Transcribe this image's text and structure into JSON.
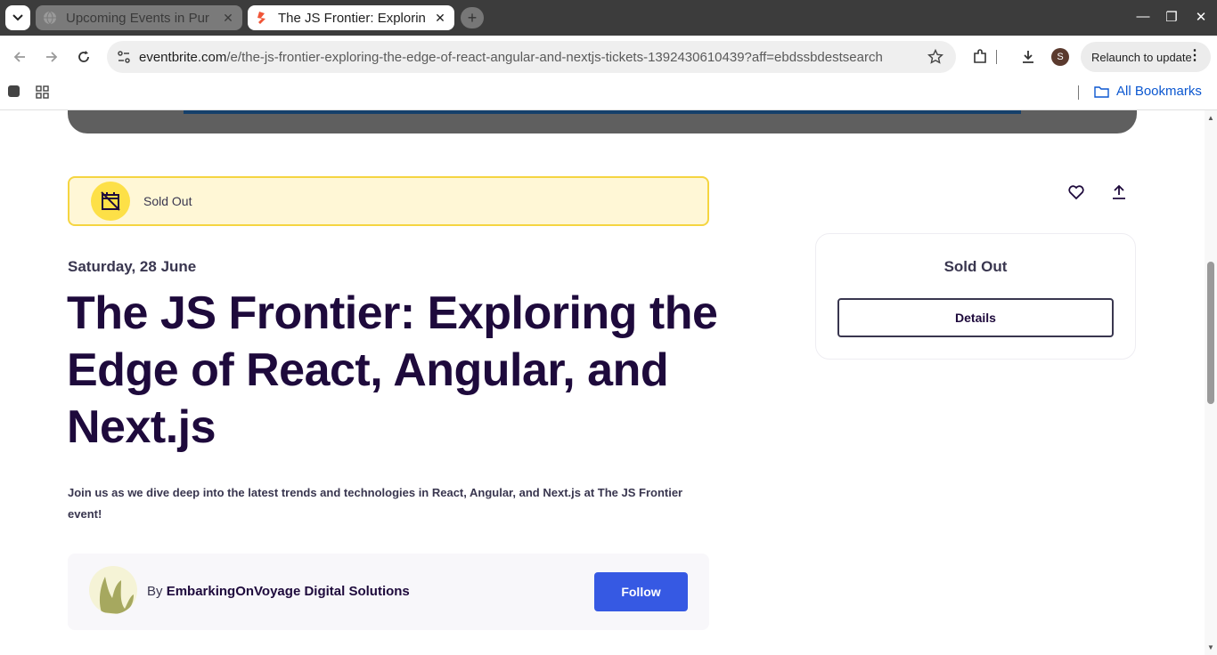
{
  "browser": {
    "tabs": [
      {
        "title": "Upcoming Events in Pur",
        "active": false
      },
      {
        "title": "The JS Frontier: Explorin",
        "active": true
      }
    ],
    "url": {
      "domain": "eventbrite.com",
      "path": "/e/the-js-frontier-exploring-the-edge-of-react-angular-and-nextjs-tickets-1392430610439?aff=ebdssbdestsearch"
    },
    "profile_initial": "S",
    "relaunch_label": "Relaunch to update",
    "all_bookmarks_label": "All Bookmarks"
  },
  "event": {
    "status_banner": "Sold Out",
    "date": "Saturday, 28 June",
    "title": "The JS Frontier: Exploring the Edge of React, Angular, and Next.js",
    "summary": "Join us as we dive deep into the latest trends and technologies in React, Angular, and Next.js at The JS Frontier event!",
    "organizer_prefix": "By",
    "organizer_name": "EmbarkingOnVoyage Digital Solutions",
    "follow_label": "Follow"
  },
  "ticket_card": {
    "status": "Sold Out",
    "details_label": "Details"
  },
  "colors": {
    "brand_accent": "#3659e3",
    "title_text": "#1e0a3c",
    "banner_bg": "#fff7d6",
    "banner_border": "#f5d541"
  },
  "icons": [
    "chevron-down-icon",
    "globe-icon",
    "eventbrite-favicon",
    "close-icon",
    "plus-icon",
    "minimize-icon",
    "maximize-icon",
    "window-close-icon",
    "back-icon",
    "forward-icon",
    "reload-icon",
    "site-info-icon",
    "star-icon",
    "extensions-icon",
    "download-icon",
    "menu-dots-icon",
    "apps-icon",
    "folder-icon",
    "calendar-off-icon",
    "heart-icon",
    "share-icon"
  ]
}
